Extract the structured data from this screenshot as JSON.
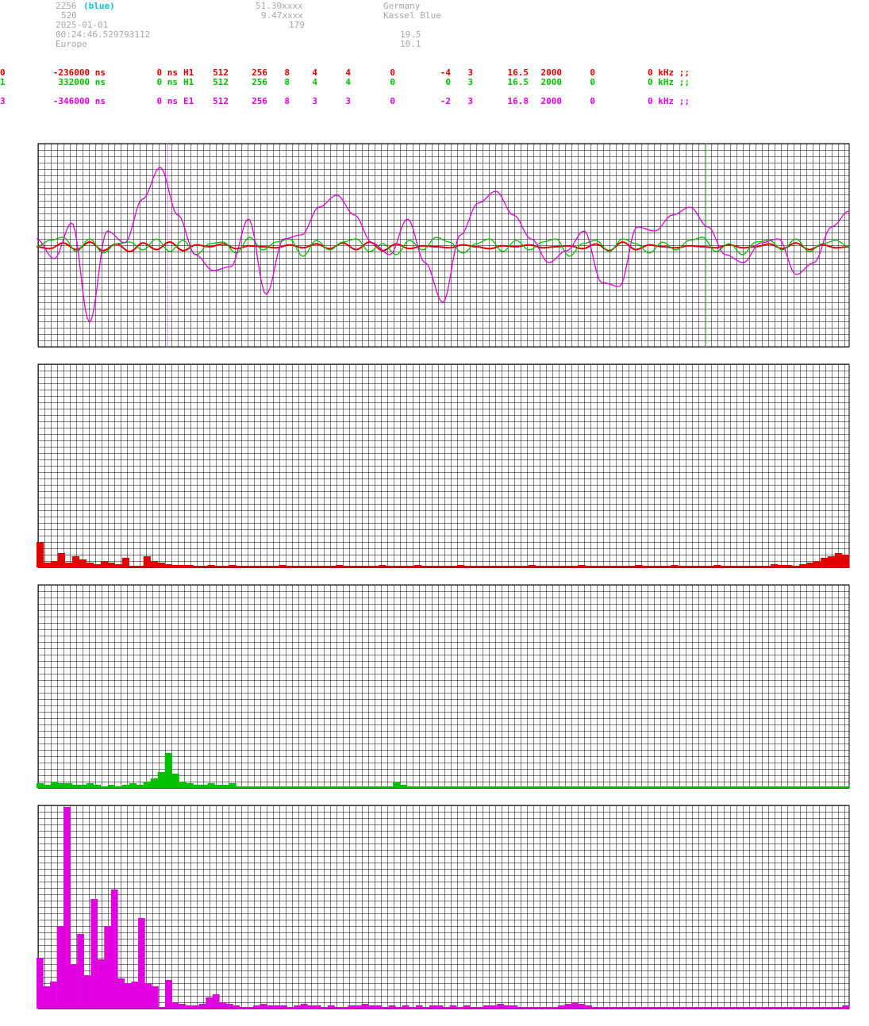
{
  "header": {
    "station_id": "2256",
    "station_tag": "(blue)",
    "num_b": "520",
    "date": "2025-01-01",
    "time": "00:24:46.529793112",
    "region": "Europe",
    "lat": "51.30xxxx",
    "lon": "9.47xxxx",
    "alt": "179",
    "country": "Germany",
    "name": "Kassel Blue",
    "val_a": "19.5",
    "val_b": "10.1"
  },
  "channels": [
    {
      "id": "0",
      "offset": "-236000 ns",
      "delay": "0 ns",
      "ant": "H1",
      "n1": "512",
      "n2": "256",
      "n3": "8",
      "n4": "4",
      "n5": "4",
      "n6": "0",
      "n7": "-4",
      "n8": "3",
      "n9": "16.5",
      "n10": "2000",
      "n11": "0",
      "freq": "0 kHz ;;",
      "color": "#e00000"
    },
    {
      "id": "1",
      "offset": "332000 ns",
      "delay": "0 ns",
      "ant": "H1",
      "n1": "512",
      "n2": "256",
      "n3": "8",
      "n4": "4",
      "n5": "4",
      "n6": "0",
      "n7": "0",
      "n8": "3",
      "n9": "16.5",
      "n10": "2000",
      "n11": "0",
      "freq": "0 kHz ;;",
      "color": "#00c000"
    },
    {
      "id": "3",
      "offset": "-346000 ns",
      "delay": "0 ns",
      "ant": "E1",
      "n1": "512",
      "n2": "256",
      "n3": "8",
      "n4": "3",
      "n5": "3",
      "n6": "0",
      "n7": "-2",
      "n8": "3",
      "n9": "16.8",
      "n10": "2000",
      "n11": "0",
      "freq": "0 kHz ;;",
      "color": "#e000e0"
    }
  ],
  "colors": {
    "grid": "#000000",
    "red": "#e00000",
    "green": "#00c000",
    "magenta": "#e000e0",
    "marker_magenta": "#c080e0",
    "marker_green": "#80e080"
  },
  "chart_data": [
    {
      "type": "line",
      "series": [
        {
          "values": [
            0,
            -2,
            4,
            -3,
            5,
            -4,
            3,
            -5,
            4,
            -3,
            5,
            -4,
            2,
            0,
            3,
            -2,
            1,
            0,
            -1,
            2,
            -1,
            3,
            -2,
            4,
            -3,
            5,
            -4,
            3,
            -2,
            1,
            0,
            -1,
            2,
            0,
            -2,
            1,
            0,
            2,
            -1,
            0,
            1,
            -2,
            3,
            -4,
            5,
            -3,
            2,
            0,
            -1,
            1,
            0,
            -1,
            2,
            -1,
            0,
            3,
            -2,
            4,
            -3,
            2,
            -1,
            0
          ]
        },
        {
          "values": [
            0,
            8,
            12,
            -6,
            10,
            -8,
            4,
            6,
            -4,
            10,
            -6,
            8,
            -10,
            4,
            6,
            -8,
            12,
            -4,
            6,
            10,
            -12,
            8,
            -4,
            6,
            10,
            -6,
            4,
            -10,
            8,
            -4,
            12,
            6,
            -8,
            4,
            10,
            -6,
            8,
            -4,
            6,
            10,
            -12,
            4,
            8,
            -6,
            10,
            4,
            -8,
            6,
            -4,
            8,
            12,
            -6,
            4,
            -10,
            6,
            8,
            -4,
            10,
            -6,
            4,
            8,
            0
          ]
        },
        {
          "values": [
            10,
            -15,
            30,
            -95,
            20,
            5,
            60,
            100,
            40,
            -10,
            -30,
            -25,
            35,
            -60,
            10,
            15,
            50,
            65,
            40,
            5,
            -10,
            35,
            -20,
            -70,
            15,
            55,
            70,
            40,
            10,
            -20,
            -5,
            20,
            -45,
            -50,
            25,
            20,
            40,
            50,
            25,
            -10,
            -20,
            5,
            10,
            -35,
            -20,
            25,
            45
          ]
        }
      ]
    },
    {
      "type": "bar",
      "values": [
        32,
        6,
        8,
        18,
        6,
        14,
        10,
        6,
        4,
        8,
        6,
        4,
        12,
        2,
        2,
        14,
        8,
        6,
        4,
        3,
        3,
        3,
        2,
        2,
        3,
        2,
        2,
        3,
        2,
        2,
        2,
        2,
        2,
        2,
        3,
        2,
        2,
        2,
        2,
        2,
        2,
        2,
        3,
        2,
        2,
        2,
        2,
        2,
        3,
        2,
        2,
        2,
        2,
        3,
        2,
        2,
        2,
        2,
        2,
        3,
        2,
        2,
        2,
        2,
        2,
        2,
        2,
        2,
        2,
        3,
        2,
        2,
        2,
        2,
        2,
        2,
        3,
        2,
        2,
        2,
        2,
        2,
        2,
        2,
        3,
        2,
        2,
        2,
        2,
        3,
        2,
        2,
        2,
        2,
        2,
        3,
        2,
        2,
        2,
        2,
        2,
        2,
        2,
        4,
        3,
        3,
        2,
        4,
        6,
        8,
        12,
        14,
        18,
        16
      ]
    },
    {
      "type": "bar",
      "values": [
        6,
        4,
        8,
        6,
        6,
        4,
        4,
        6,
        4,
        2,
        4,
        2,
        4,
        6,
        4,
        8,
        12,
        20,
        44,
        18,
        8,
        6,
        4,
        4,
        6,
        4,
        4,
        6,
        2,
        2,
        2,
        2,
        2,
        2,
        2,
        2,
        2,
        2,
        2,
        2,
        2,
        2,
        2,
        2,
        2,
        2,
        2,
        2,
        2,
        2,
        8,
        4,
        2,
        2,
        2,
        2,
        2,
        2,
        2,
        2,
        2,
        2,
        2,
        2,
        2,
        2,
        2,
        2,
        2,
        2,
        2,
        2,
        2,
        2,
        2,
        2,
        2,
        2,
        2,
        2,
        2,
        2,
        2,
        2,
        2,
        2,
        2,
        2,
        2,
        2,
        2,
        2,
        2,
        2,
        2,
        2,
        2,
        2,
        2,
        2,
        2,
        2,
        2,
        2,
        2,
        2,
        2,
        2,
        2,
        2,
        2,
        2,
        2,
        2
      ]
    },
    {
      "type": "bar",
      "values": [
        64,
        28,
        34,
        104,
        254,
        56,
        94,
        42,
        138,
        62,
        104,
        150,
        38,
        32,
        34,
        114,
        32,
        28,
        2,
        36,
        8,
        6,
        4,
        4,
        6,
        14,
        18,
        8,
        6,
        4,
        2,
        2,
        4,
        6,
        4,
        4,
        4,
        2,
        4,
        6,
        4,
        4,
        2,
        4,
        2,
        2,
        4,
        4,
        6,
        4,
        4,
        2,
        4,
        2,
        4,
        2,
        4,
        2,
        4,
        4,
        2,
        4,
        2,
        4,
        2,
        2,
        4,
        4,
        6,
        4,
        4,
        2,
        2,
        2,
        2,
        2,
        2,
        4,
        6,
        8,
        6,
        4,
        2,
        2,
        2,
        2,
        2,
        2,
        2,
        2,
        2,
        2,
        2,
        2,
        2,
        2,
        2,
        2,
        2,
        2,
        2,
        2,
        2,
        2,
        2,
        2,
        2,
        2,
        2,
        2,
        2,
        2,
        2,
        2,
        2,
        2,
        2,
        2,
        2,
        4
      ]
    }
  ]
}
